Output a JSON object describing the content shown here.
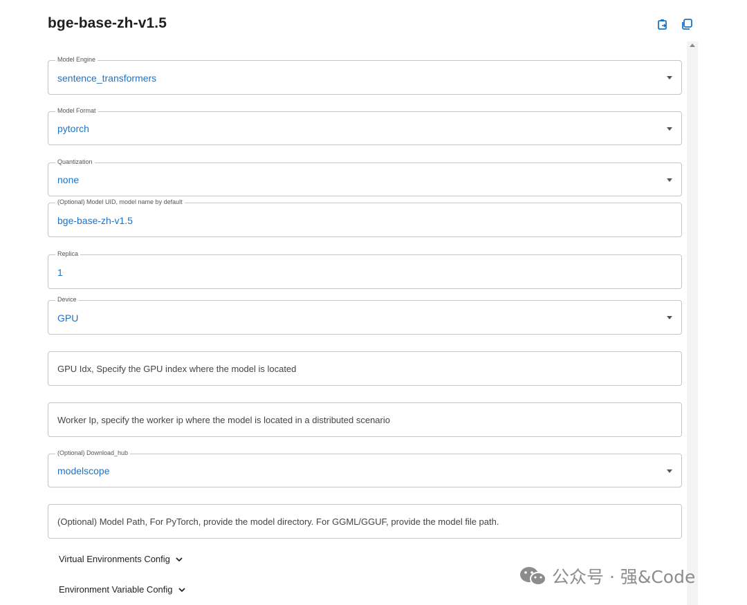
{
  "header": {
    "title": "bge-base-zh-v1.5",
    "icons": [
      "copy-refresh-icon",
      "copy-icon"
    ]
  },
  "form": {
    "model_engine": {
      "label": "Model Engine",
      "value": "sentence_transformers"
    },
    "model_format": {
      "label": "Model Format",
      "value": "pytorch"
    },
    "quantization": {
      "label": "Quantization",
      "value": "none"
    },
    "model_uid": {
      "label": "(Optional) Model UID, model name by default",
      "value": "bge-base-zh-v1.5"
    },
    "replica": {
      "label": "Replica",
      "value": "1"
    },
    "device": {
      "label": "Device",
      "value": "GPU"
    },
    "gpu_idx": {
      "placeholder": "GPU Idx, Specify the GPU index where the model is located"
    },
    "worker_ip": {
      "placeholder": "Worker Ip, specify the worker ip where the model is located in a distributed scenario"
    },
    "download_hub": {
      "label": "(Optional) Download_hub",
      "value": "modelscope"
    },
    "model_path": {
      "placeholder": "(Optional) Model Path, For PyTorch, provide the model directory. For GGML/GGUF, provide the model file path."
    }
  },
  "accordions": {
    "virtual_env": "Virtual Environments Config",
    "env_var": "Environment Variable Config"
  },
  "watermark": {
    "text": "公众号 · 强&Code"
  },
  "colors": {
    "value_text": "#1a73c8",
    "border": "#c4c4c4"
  }
}
